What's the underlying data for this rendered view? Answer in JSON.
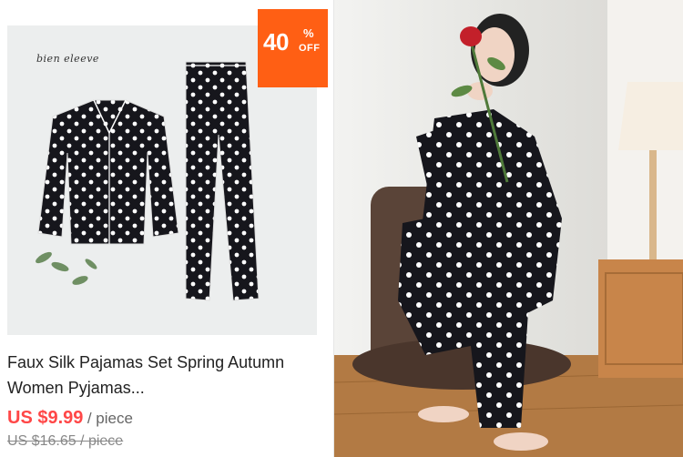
{
  "product": {
    "brand": "bien eleeve",
    "discount": {
      "value": "40",
      "percent": "%",
      "off": "OFF"
    },
    "title": "Faux Silk Pajamas Set Spring Autumn Women Pyjamas...",
    "price": "US $9.99",
    "price_unit": "/ piece",
    "original_price": "US $16.65 / piece"
  },
  "colors": {
    "badge": "#ff5f14",
    "price": "#ff4747",
    "pajama": "#16161c"
  }
}
